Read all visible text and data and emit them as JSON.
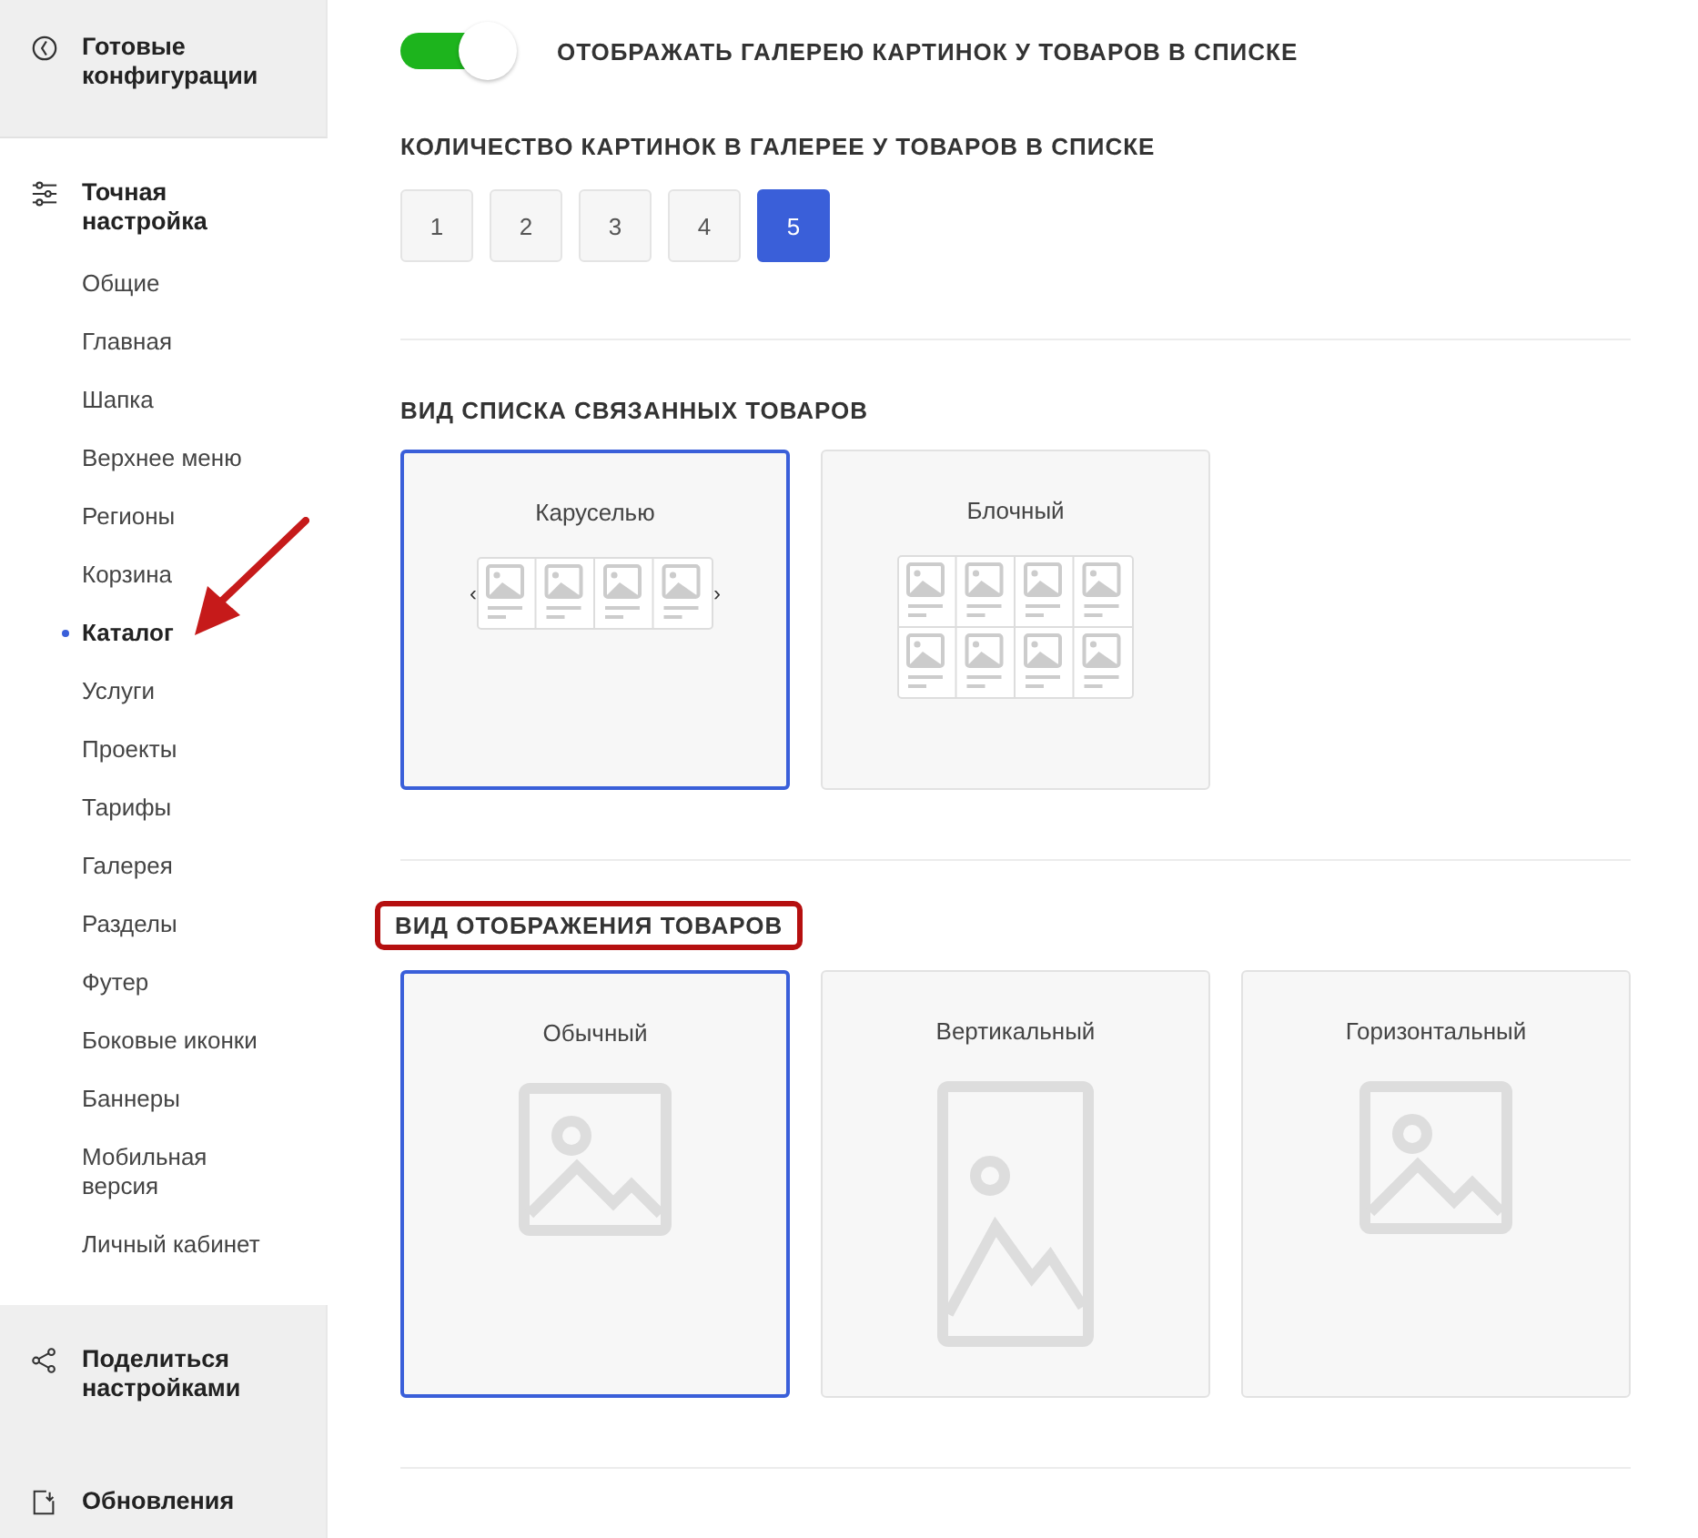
{
  "sidebar": {
    "top": {
      "label": "Готовые конфигурации"
    },
    "section": {
      "label": "Точная настройка",
      "items": [
        {
          "label": "Общие",
          "selected": false,
          "arrow": false
        },
        {
          "label": "Главная",
          "selected": false,
          "arrow": false
        },
        {
          "label": "Шапка",
          "selected": false,
          "arrow": false
        },
        {
          "label": "Верхнее меню",
          "selected": false,
          "arrow": false
        },
        {
          "label": "Регионы",
          "selected": false,
          "arrow": false
        },
        {
          "label": "Корзина",
          "selected": false,
          "arrow": false
        },
        {
          "label": "Каталог",
          "selected": true,
          "arrow": true
        },
        {
          "label": "Услуги",
          "selected": false,
          "arrow": false
        },
        {
          "label": "Проекты",
          "selected": false,
          "arrow": false
        },
        {
          "label": "Тарифы",
          "selected": false,
          "arrow": false
        },
        {
          "label": "Галерея",
          "selected": false,
          "arrow": false
        },
        {
          "label": "Разделы",
          "selected": false,
          "arrow": false
        },
        {
          "label": "Футер",
          "selected": false,
          "arrow": false
        },
        {
          "label": "Боковые иконки",
          "selected": false,
          "arrow": false
        },
        {
          "label": "Баннеры",
          "selected": false,
          "arrow": false
        },
        {
          "label": "Мобильная версия",
          "selected": false,
          "arrow": false
        },
        {
          "label": "Личный кабинет",
          "selected": false,
          "arrow": false
        }
      ]
    },
    "bottom": [
      {
        "label": "Поделиться настройками",
        "kind": "share"
      },
      {
        "label": "Обновления",
        "kind": "update"
      }
    ]
  },
  "gallery": {
    "toggle": {
      "label": "ОТОБРАЖАТЬ ГАЛЕРЕЮ КАРТИНОК У ТОВАРОВ В СПИСКЕ",
      "on": true
    },
    "count_title": "КОЛИЧЕСТВО КАРТИНОК В ГАЛЕРЕЕ У ТОВАРОВ В СПИСКЕ",
    "counts": [
      {
        "label": "1",
        "selected": false
      },
      {
        "label": "2",
        "selected": false
      },
      {
        "label": "3",
        "selected": false
      },
      {
        "label": "4",
        "selected": false
      },
      {
        "label": "5",
        "selected": true
      }
    ]
  },
  "sections": [
    {
      "title": "ВИД СПИСКА СВЯЗАННЫХ ТОВАРОВ",
      "highlighted": false,
      "options": [
        {
          "label": "Каруселью",
          "kind": "carousel",
          "selected": true,
          "prev": "‹",
          "next": "›"
        },
        {
          "label": "Блочный",
          "kind": "blocks",
          "selected": false
        }
      ]
    },
    {
      "title": "ВИД ОТОБРАЖЕНИЯ ТОВАРОВ",
      "highlighted": true,
      "options": [
        {
          "label": "Обычный",
          "kind": "normal",
          "selected": true
        },
        {
          "label": "Вертикальный",
          "kind": "vertical",
          "selected": false
        },
        {
          "label": "Горизонтальный",
          "kind": "horizontal",
          "selected": false
        }
      ]
    }
  ]
}
